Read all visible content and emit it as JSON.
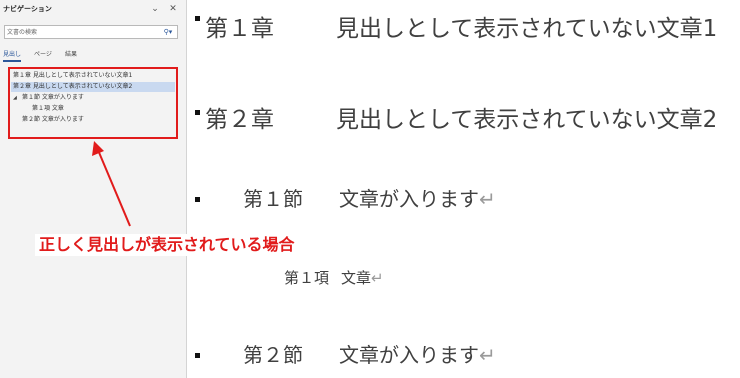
{
  "nav": {
    "title": "ナビゲーション",
    "dropdown_icon": "chevron-down",
    "close_icon": "close",
    "search": {
      "placeholder": "文書の検索",
      "icon": "search"
    },
    "tabs": [
      {
        "label": "見出し",
        "active": true
      },
      {
        "label": "ページ",
        "active": false
      },
      {
        "label": "結果",
        "active": false
      }
    ],
    "tree": [
      {
        "label": "第１章 見出しとして表示されていない文章1",
        "level": 1,
        "selected": false
      },
      {
        "label": "第２章 見出しとして表示されていない文章2",
        "level": 1,
        "selected": true
      },
      {
        "label": "第１節 文章が入ります",
        "level": 2,
        "expanded": true
      },
      {
        "label": "第１項 文章",
        "level": 3
      },
      {
        "label": "第２節 文章が入ります",
        "level": 2
      }
    ]
  },
  "document": {
    "lines": [
      {
        "num": "第１章",
        "text": "見出しとして表示されていない文章1"
      },
      {
        "num": "第２章",
        "text": "見出しとして表示されていない文章2"
      },
      {
        "num": "第１節",
        "text": "文章が入ります"
      },
      {
        "num": "第１項",
        "text": "文章"
      },
      {
        "num": "第２節",
        "text": "文章が入ります"
      }
    ],
    "return_mark": "↵"
  },
  "annotation": {
    "text": "正しく見出しが表示されている場合",
    "color": "#e11b1b"
  },
  "colors": {
    "accent": "#2b579a",
    "highlight": "#e11b1b",
    "selected_row": "#c9d9f0"
  }
}
